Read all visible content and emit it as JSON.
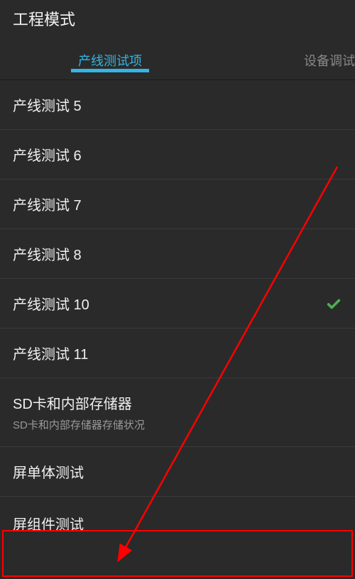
{
  "header": {
    "title": "工程模式"
  },
  "tabs": {
    "active": "产线测试项",
    "inactive": "设备调试"
  },
  "items": [
    {
      "title": "产线测试 5",
      "subtitle": "",
      "checked": false
    },
    {
      "title": "产线测试 6",
      "subtitle": "",
      "checked": false
    },
    {
      "title": "产线测试 7",
      "subtitle": "",
      "checked": false
    },
    {
      "title": "产线测试 8",
      "subtitle": "",
      "checked": false
    },
    {
      "title": "产线测试 10",
      "subtitle": "",
      "checked": true
    },
    {
      "title": "产线测试 11",
      "subtitle": "",
      "checked": false
    },
    {
      "title": "SD卡和内部存储器",
      "subtitle": "SD卡和内部存储器存储状况",
      "checked": false
    },
    {
      "title": "屏单体测试",
      "subtitle": "",
      "checked": false
    },
    {
      "title": "屏组件测试",
      "subtitle": "",
      "checked": false
    }
  ]
}
